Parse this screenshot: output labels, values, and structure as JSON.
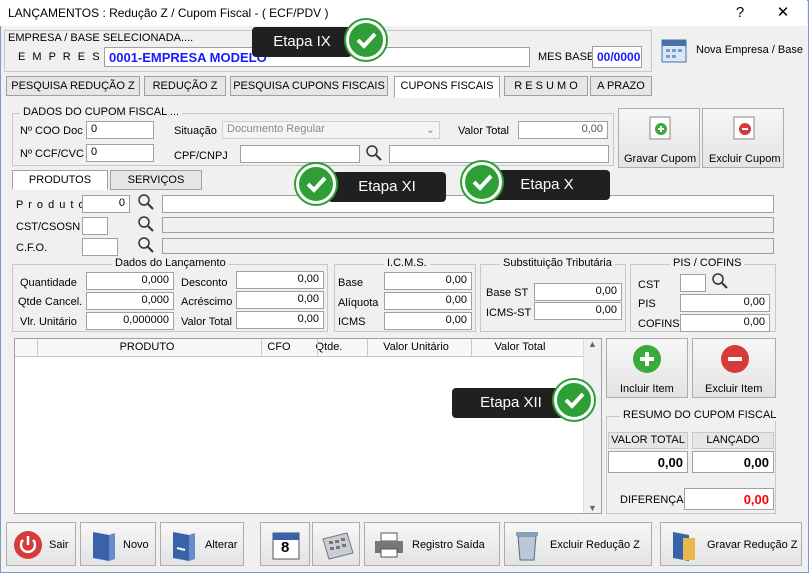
{
  "window": {
    "title": "LANÇAMENTOS : Redução Z / Cupom Fiscal - ( ECF/PDV )",
    "help": "?",
    "close": "✕"
  },
  "empresa": {
    "section_title": "EMPRESA  /  BASE  SELECIONADA....",
    "label": "E M P R E S A",
    "value": "0001-EMPRESA MODELO",
    "mes_base_label": "MES BASE",
    "mes_base_value": "00/0000",
    "nova_empresa": "Nova Empresa / Base"
  },
  "tabs": [
    "PESQUISA REDUÇÃO Z",
    "REDUÇÃO Z",
    "PESQUISA CUPONS FISCAIS",
    "CUPONS FISCAIS",
    "R E S U M O",
    "A PRAZO"
  ],
  "cupom": {
    "title": "DADOS DO CUPOM FISCAL ...",
    "coo_label": "Nº COO Doc",
    "coo_value": "0",
    "ccf_label": "Nº CCF/CVC",
    "ccf_value": "0",
    "situacao_label": "Situação",
    "situacao_value": "Documento Regular",
    "valor_total_label": "Valor Total",
    "valor_total_value": "0,00",
    "cpf_label": "CPF/CNPJ"
  },
  "cupom_buttons": {
    "gravar": "Gravar Cupom",
    "excluir": "Excluir Cupom"
  },
  "subtabs": [
    "PRODUTOS",
    "SERVIÇOS"
  ],
  "produto": {
    "produto_label": "P r o d u t o",
    "produto_value": "0",
    "cst_label": "CST/CSOSN",
    "cfo_label": "C.F.O."
  },
  "lancamento": {
    "title": "Dados  do  Lançamento",
    "quantidade_label": "Quantidade",
    "quantidade_value": "0,000",
    "qtde_cancel_label": "Qtde Cancel.",
    "qtde_cancel_value": "0,000",
    "vlr_unitario_label": "Vlr. Unitário",
    "vlr_unitario_value": "0,000000",
    "desconto_label": "Desconto",
    "desconto_value": "0,00",
    "acrescimo_label": "Acréscimo",
    "acrescimo_value": "0,00",
    "valor_total_label": "Valor Total",
    "valor_total_value": "0,00"
  },
  "icms": {
    "title": "I.C.M.S.",
    "base_label": "Base",
    "base_value": "0,00",
    "aliquota_label": "Alíquota",
    "aliquota_value": "0,00",
    "icms_label": "ICMS",
    "icms_value": "0,00"
  },
  "st": {
    "title": "Substituição Tributária",
    "base_st_label": "Base ST",
    "base_st_value": "0,00",
    "icms_st_label": "ICMS-ST",
    "icms_st_value": "0,00"
  },
  "pis": {
    "title": "PIS / COFINS",
    "cst_label": "CST",
    "pis_label": "PIS",
    "pis_value": "0,00",
    "cofins_label": "COFINS",
    "cofins_value": "0,00"
  },
  "grid": {
    "columns": [
      "PRODUTO",
      "CFO",
      "Qtde.",
      "Valor Unitário",
      "Valor Total"
    ]
  },
  "item_buttons": {
    "incluir": "Incluir Item",
    "excluir": "Excluir Item"
  },
  "resumo": {
    "title": "RESUMO DO CUPOM FISCAL",
    "valor_total_label": "VALOR TOTAL",
    "lancado_label": "LANÇADO",
    "valor_total_value": "0,00",
    "lancado_value": "0,00",
    "diferenca_label": "DIFERENÇA",
    "diferenca_value": "0,00"
  },
  "toolbar": {
    "sair": "Sair",
    "novo": "Novo",
    "alterar": "Alterar",
    "calendar_day": "8",
    "registro_saida": "Registro Saída",
    "excluir_reducao": "Excluir Redução Z",
    "gravar_reducao": "Gravar Redução Z"
  },
  "callouts": [
    "Etapa IX",
    "Etapa XI",
    "Etapa X",
    "Etapa XII"
  ],
  "colors": {
    "accent_blue": "#1a1aff",
    "callout_bg": "#202020",
    "check_green": "#2e9e36",
    "diff_red": "#ff0000"
  }
}
